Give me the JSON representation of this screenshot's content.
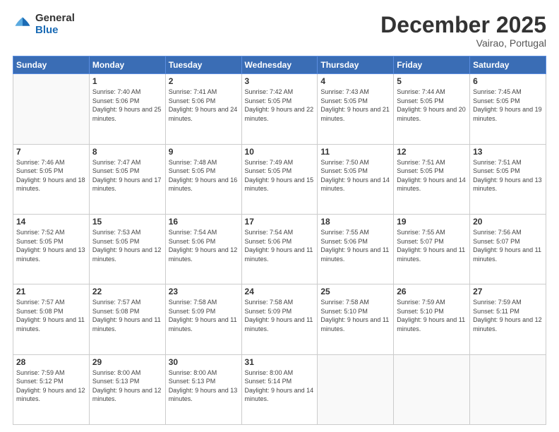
{
  "logo": {
    "general": "General",
    "blue": "Blue"
  },
  "header": {
    "month": "December 2025",
    "location": "Vairao, Portugal"
  },
  "weekdays": [
    "Sunday",
    "Monday",
    "Tuesday",
    "Wednesday",
    "Thursday",
    "Friday",
    "Saturday"
  ],
  "weeks": [
    [
      {
        "day": "",
        "sunrise": "",
        "sunset": "",
        "daylight": "",
        "empty": true
      },
      {
        "day": "1",
        "sunrise": "Sunrise: 7:40 AM",
        "sunset": "Sunset: 5:06 PM",
        "daylight": "Daylight: 9 hours and 25 minutes.",
        "empty": false
      },
      {
        "day": "2",
        "sunrise": "Sunrise: 7:41 AM",
        "sunset": "Sunset: 5:06 PM",
        "daylight": "Daylight: 9 hours and 24 minutes.",
        "empty": false
      },
      {
        "day": "3",
        "sunrise": "Sunrise: 7:42 AM",
        "sunset": "Sunset: 5:05 PM",
        "daylight": "Daylight: 9 hours and 22 minutes.",
        "empty": false
      },
      {
        "day": "4",
        "sunrise": "Sunrise: 7:43 AM",
        "sunset": "Sunset: 5:05 PM",
        "daylight": "Daylight: 9 hours and 21 minutes.",
        "empty": false
      },
      {
        "day": "5",
        "sunrise": "Sunrise: 7:44 AM",
        "sunset": "Sunset: 5:05 PM",
        "daylight": "Daylight: 9 hours and 20 minutes.",
        "empty": false
      },
      {
        "day": "6",
        "sunrise": "Sunrise: 7:45 AM",
        "sunset": "Sunset: 5:05 PM",
        "daylight": "Daylight: 9 hours and 19 minutes.",
        "empty": false
      }
    ],
    [
      {
        "day": "7",
        "sunrise": "Sunrise: 7:46 AM",
        "sunset": "Sunset: 5:05 PM",
        "daylight": "Daylight: 9 hours and 18 minutes.",
        "empty": false
      },
      {
        "day": "8",
        "sunrise": "Sunrise: 7:47 AM",
        "sunset": "Sunset: 5:05 PM",
        "daylight": "Daylight: 9 hours and 17 minutes.",
        "empty": false
      },
      {
        "day": "9",
        "sunrise": "Sunrise: 7:48 AM",
        "sunset": "Sunset: 5:05 PM",
        "daylight": "Daylight: 9 hours and 16 minutes.",
        "empty": false
      },
      {
        "day": "10",
        "sunrise": "Sunrise: 7:49 AM",
        "sunset": "Sunset: 5:05 PM",
        "daylight": "Daylight: 9 hours and 15 minutes.",
        "empty": false
      },
      {
        "day": "11",
        "sunrise": "Sunrise: 7:50 AM",
        "sunset": "Sunset: 5:05 PM",
        "daylight": "Daylight: 9 hours and 14 minutes.",
        "empty": false
      },
      {
        "day": "12",
        "sunrise": "Sunrise: 7:51 AM",
        "sunset": "Sunset: 5:05 PM",
        "daylight": "Daylight: 9 hours and 14 minutes.",
        "empty": false
      },
      {
        "day": "13",
        "sunrise": "Sunrise: 7:51 AM",
        "sunset": "Sunset: 5:05 PM",
        "daylight": "Daylight: 9 hours and 13 minutes.",
        "empty": false
      }
    ],
    [
      {
        "day": "14",
        "sunrise": "Sunrise: 7:52 AM",
        "sunset": "Sunset: 5:05 PM",
        "daylight": "Daylight: 9 hours and 13 minutes.",
        "empty": false
      },
      {
        "day": "15",
        "sunrise": "Sunrise: 7:53 AM",
        "sunset": "Sunset: 5:05 PM",
        "daylight": "Daylight: 9 hours and 12 minutes.",
        "empty": false
      },
      {
        "day": "16",
        "sunrise": "Sunrise: 7:54 AM",
        "sunset": "Sunset: 5:06 PM",
        "daylight": "Daylight: 9 hours and 12 minutes.",
        "empty": false
      },
      {
        "day": "17",
        "sunrise": "Sunrise: 7:54 AM",
        "sunset": "Sunset: 5:06 PM",
        "daylight": "Daylight: 9 hours and 11 minutes.",
        "empty": false
      },
      {
        "day": "18",
        "sunrise": "Sunrise: 7:55 AM",
        "sunset": "Sunset: 5:06 PM",
        "daylight": "Daylight: 9 hours and 11 minutes.",
        "empty": false
      },
      {
        "day": "19",
        "sunrise": "Sunrise: 7:55 AM",
        "sunset": "Sunset: 5:07 PM",
        "daylight": "Daylight: 9 hours and 11 minutes.",
        "empty": false
      },
      {
        "day": "20",
        "sunrise": "Sunrise: 7:56 AM",
        "sunset": "Sunset: 5:07 PM",
        "daylight": "Daylight: 9 hours and 11 minutes.",
        "empty": false
      }
    ],
    [
      {
        "day": "21",
        "sunrise": "Sunrise: 7:57 AM",
        "sunset": "Sunset: 5:08 PM",
        "daylight": "Daylight: 9 hours and 11 minutes.",
        "empty": false
      },
      {
        "day": "22",
        "sunrise": "Sunrise: 7:57 AM",
        "sunset": "Sunset: 5:08 PM",
        "daylight": "Daylight: 9 hours and 11 minutes.",
        "empty": false
      },
      {
        "day": "23",
        "sunrise": "Sunrise: 7:58 AM",
        "sunset": "Sunset: 5:09 PM",
        "daylight": "Daylight: 9 hours and 11 minutes.",
        "empty": false
      },
      {
        "day": "24",
        "sunrise": "Sunrise: 7:58 AM",
        "sunset": "Sunset: 5:09 PM",
        "daylight": "Daylight: 9 hours and 11 minutes.",
        "empty": false
      },
      {
        "day": "25",
        "sunrise": "Sunrise: 7:58 AM",
        "sunset": "Sunset: 5:10 PM",
        "daylight": "Daylight: 9 hours and 11 minutes.",
        "empty": false
      },
      {
        "day": "26",
        "sunrise": "Sunrise: 7:59 AM",
        "sunset": "Sunset: 5:10 PM",
        "daylight": "Daylight: 9 hours and 11 minutes.",
        "empty": false
      },
      {
        "day": "27",
        "sunrise": "Sunrise: 7:59 AM",
        "sunset": "Sunset: 5:11 PM",
        "daylight": "Daylight: 9 hours and 12 minutes.",
        "empty": false
      }
    ],
    [
      {
        "day": "28",
        "sunrise": "Sunrise: 7:59 AM",
        "sunset": "Sunset: 5:12 PM",
        "daylight": "Daylight: 9 hours and 12 minutes.",
        "empty": false
      },
      {
        "day": "29",
        "sunrise": "Sunrise: 8:00 AM",
        "sunset": "Sunset: 5:13 PM",
        "daylight": "Daylight: 9 hours and 12 minutes.",
        "empty": false
      },
      {
        "day": "30",
        "sunrise": "Sunrise: 8:00 AM",
        "sunset": "Sunset: 5:13 PM",
        "daylight": "Daylight: 9 hours and 13 minutes.",
        "empty": false
      },
      {
        "day": "31",
        "sunrise": "Sunrise: 8:00 AM",
        "sunset": "Sunset: 5:14 PM",
        "daylight": "Daylight: 9 hours and 14 minutes.",
        "empty": false
      },
      {
        "day": "",
        "sunrise": "",
        "sunset": "",
        "daylight": "",
        "empty": true
      },
      {
        "day": "",
        "sunrise": "",
        "sunset": "",
        "daylight": "",
        "empty": true
      },
      {
        "day": "",
        "sunrise": "",
        "sunset": "",
        "daylight": "",
        "empty": true
      }
    ]
  ]
}
